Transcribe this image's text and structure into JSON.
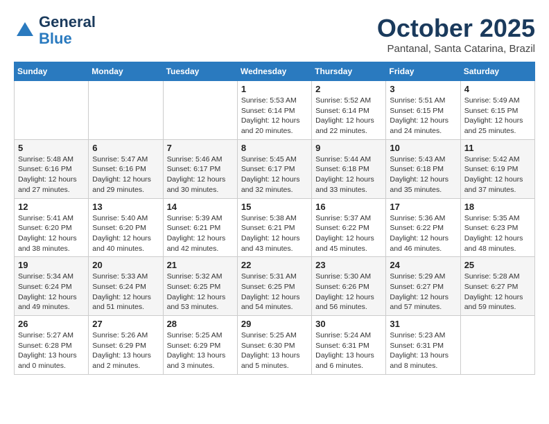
{
  "header": {
    "logo_general": "General",
    "logo_blue": "Blue",
    "month": "October 2025",
    "location": "Pantanal, Santa Catarina, Brazil"
  },
  "weekdays": [
    "Sunday",
    "Monday",
    "Tuesday",
    "Wednesday",
    "Thursday",
    "Friday",
    "Saturday"
  ],
  "weeks": [
    [
      {
        "day": "",
        "info": ""
      },
      {
        "day": "",
        "info": ""
      },
      {
        "day": "",
        "info": ""
      },
      {
        "day": "1",
        "info": "Sunrise: 5:53 AM\nSunset: 6:14 PM\nDaylight: 12 hours\nand 20 minutes."
      },
      {
        "day": "2",
        "info": "Sunrise: 5:52 AM\nSunset: 6:14 PM\nDaylight: 12 hours\nand 22 minutes."
      },
      {
        "day": "3",
        "info": "Sunrise: 5:51 AM\nSunset: 6:15 PM\nDaylight: 12 hours\nand 24 minutes."
      },
      {
        "day": "4",
        "info": "Sunrise: 5:49 AM\nSunset: 6:15 PM\nDaylight: 12 hours\nand 25 minutes."
      }
    ],
    [
      {
        "day": "5",
        "info": "Sunrise: 5:48 AM\nSunset: 6:16 PM\nDaylight: 12 hours\nand 27 minutes."
      },
      {
        "day": "6",
        "info": "Sunrise: 5:47 AM\nSunset: 6:16 PM\nDaylight: 12 hours\nand 29 minutes."
      },
      {
        "day": "7",
        "info": "Sunrise: 5:46 AM\nSunset: 6:17 PM\nDaylight: 12 hours\nand 30 minutes."
      },
      {
        "day": "8",
        "info": "Sunrise: 5:45 AM\nSunset: 6:17 PM\nDaylight: 12 hours\nand 32 minutes."
      },
      {
        "day": "9",
        "info": "Sunrise: 5:44 AM\nSunset: 6:18 PM\nDaylight: 12 hours\nand 33 minutes."
      },
      {
        "day": "10",
        "info": "Sunrise: 5:43 AM\nSunset: 6:18 PM\nDaylight: 12 hours\nand 35 minutes."
      },
      {
        "day": "11",
        "info": "Sunrise: 5:42 AM\nSunset: 6:19 PM\nDaylight: 12 hours\nand 37 minutes."
      }
    ],
    [
      {
        "day": "12",
        "info": "Sunrise: 5:41 AM\nSunset: 6:20 PM\nDaylight: 12 hours\nand 38 minutes."
      },
      {
        "day": "13",
        "info": "Sunrise: 5:40 AM\nSunset: 6:20 PM\nDaylight: 12 hours\nand 40 minutes."
      },
      {
        "day": "14",
        "info": "Sunrise: 5:39 AM\nSunset: 6:21 PM\nDaylight: 12 hours\nand 42 minutes."
      },
      {
        "day": "15",
        "info": "Sunrise: 5:38 AM\nSunset: 6:21 PM\nDaylight: 12 hours\nand 43 minutes."
      },
      {
        "day": "16",
        "info": "Sunrise: 5:37 AM\nSunset: 6:22 PM\nDaylight: 12 hours\nand 45 minutes."
      },
      {
        "day": "17",
        "info": "Sunrise: 5:36 AM\nSunset: 6:22 PM\nDaylight: 12 hours\nand 46 minutes."
      },
      {
        "day": "18",
        "info": "Sunrise: 5:35 AM\nSunset: 6:23 PM\nDaylight: 12 hours\nand 48 minutes."
      }
    ],
    [
      {
        "day": "19",
        "info": "Sunrise: 5:34 AM\nSunset: 6:24 PM\nDaylight: 12 hours\nand 49 minutes."
      },
      {
        "day": "20",
        "info": "Sunrise: 5:33 AM\nSunset: 6:24 PM\nDaylight: 12 hours\nand 51 minutes."
      },
      {
        "day": "21",
        "info": "Sunrise: 5:32 AM\nSunset: 6:25 PM\nDaylight: 12 hours\nand 53 minutes."
      },
      {
        "day": "22",
        "info": "Sunrise: 5:31 AM\nSunset: 6:25 PM\nDaylight: 12 hours\nand 54 minutes."
      },
      {
        "day": "23",
        "info": "Sunrise: 5:30 AM\nSunset: 6:26 PM\nDaylight: 12 hours\nand 56 minutes."
      },
      {
        "day": "24",
        "info": "Sunrise: 5:29 AM\nSunset: 6:27 PM\nDaylight: 12 hours\nand 57 minutes."
      },
      {
        "day": "25",
        "info": "Sunrise: 5:28 AM\nSunset: 6:27 PM\nDaylight: 12 hours\nand 59 minutes."
      }
    ],
    [
      {
        "day": "26",
        "info": "Sunrise: 5:27 AM\nSunset: 6:28 PM\nDaylight: 13 hours\nand 0 minutes."
      },
      {
        "day": "27",
        "info": "Sunrise: 5:26 AM\nSunset: 6:29 PM\nDaylight: 13 hours\nand 2 minutes."
      },
      {
        "day": "28",
        "info": "Sunrise: 5:25 AM\nSunset: 6:29 PM\nDaylight: 13 hours\nand 3 minutes."
      },
      {
        "day": "29",
        "info": "Sunrise: 5:25 AM\nSunset: 6:30 PM\nDaylight: 13 hours\nand 5 minutes."
      },
      {
        "day": "30",
        "info": "Sunrise: 5:24 AM\nSunset: 6:31 PM\nDaylight: 13 hours\nand 6 minutes."
      },
      {
        "day": "31",
        "info": "Sunrise: 5:23 AM\nSunset: 6:31 PM\nDaylight: 13 hours\nand 8 minutes."
      },
      {
        "day": "",
        "info": ""
      }
    ]
  ]
}
